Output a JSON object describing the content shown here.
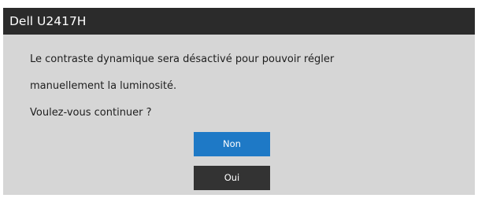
{
  "window": {
    "title": "Dell U2417H"
  },
  "message": {
    "lines": [
      "Le contraste dynamique sera désactivé pour pouvoir régler",
      "manuellement la luminosité.",
      "Voulez-vous continuer ?"
    ]
  },
  "buttons": {
    "non": {
      "label": "Non",
      "selected": true,
      "color": "#1e79c6"
    },
    "oui": {
      "label": "Oui",
      "selected": false,
      "color": "#333333"
    }
  },
  "colors": {
    "title_bar": "#2b2b2b",
    "dialog_background": "#d6d6d6",
    "text": "#1e1e1e"
  }
}
